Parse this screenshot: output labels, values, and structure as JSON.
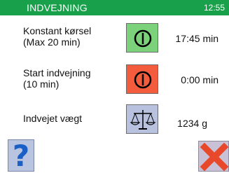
{
  "header": {
    "title": "INDVEJNING",
    "clock": "12:55",
    "accent_color": "#18a04a"
  },
  "rows": [
    {
      "label_line1": "Konstant kørsel",
      "label_line2": "(Max 20 min)",
      "button_icon": "power-icon",
      "button_color": "#7cd27a",
      "value": "17:45 min"
    },
    {
      "label_line1": "Start indvejning",
      "label_line2": "(10 min)",
      "button_icon": "power-icon",
      "button_color": "#f35c3c",
      "value": "0:00 min"
    },
    {
      "label_line1": "Indvejet vægt",
      "button_icon": "scale-icon",
      "button_color": "#b8c2de",
      "value": "1234 g"
    }
  ],
  "footer": {
    "help_icon": "question-mark-icon",
    "help_glyph": "?",
    "close_icon": "close-icon"
  }
}
